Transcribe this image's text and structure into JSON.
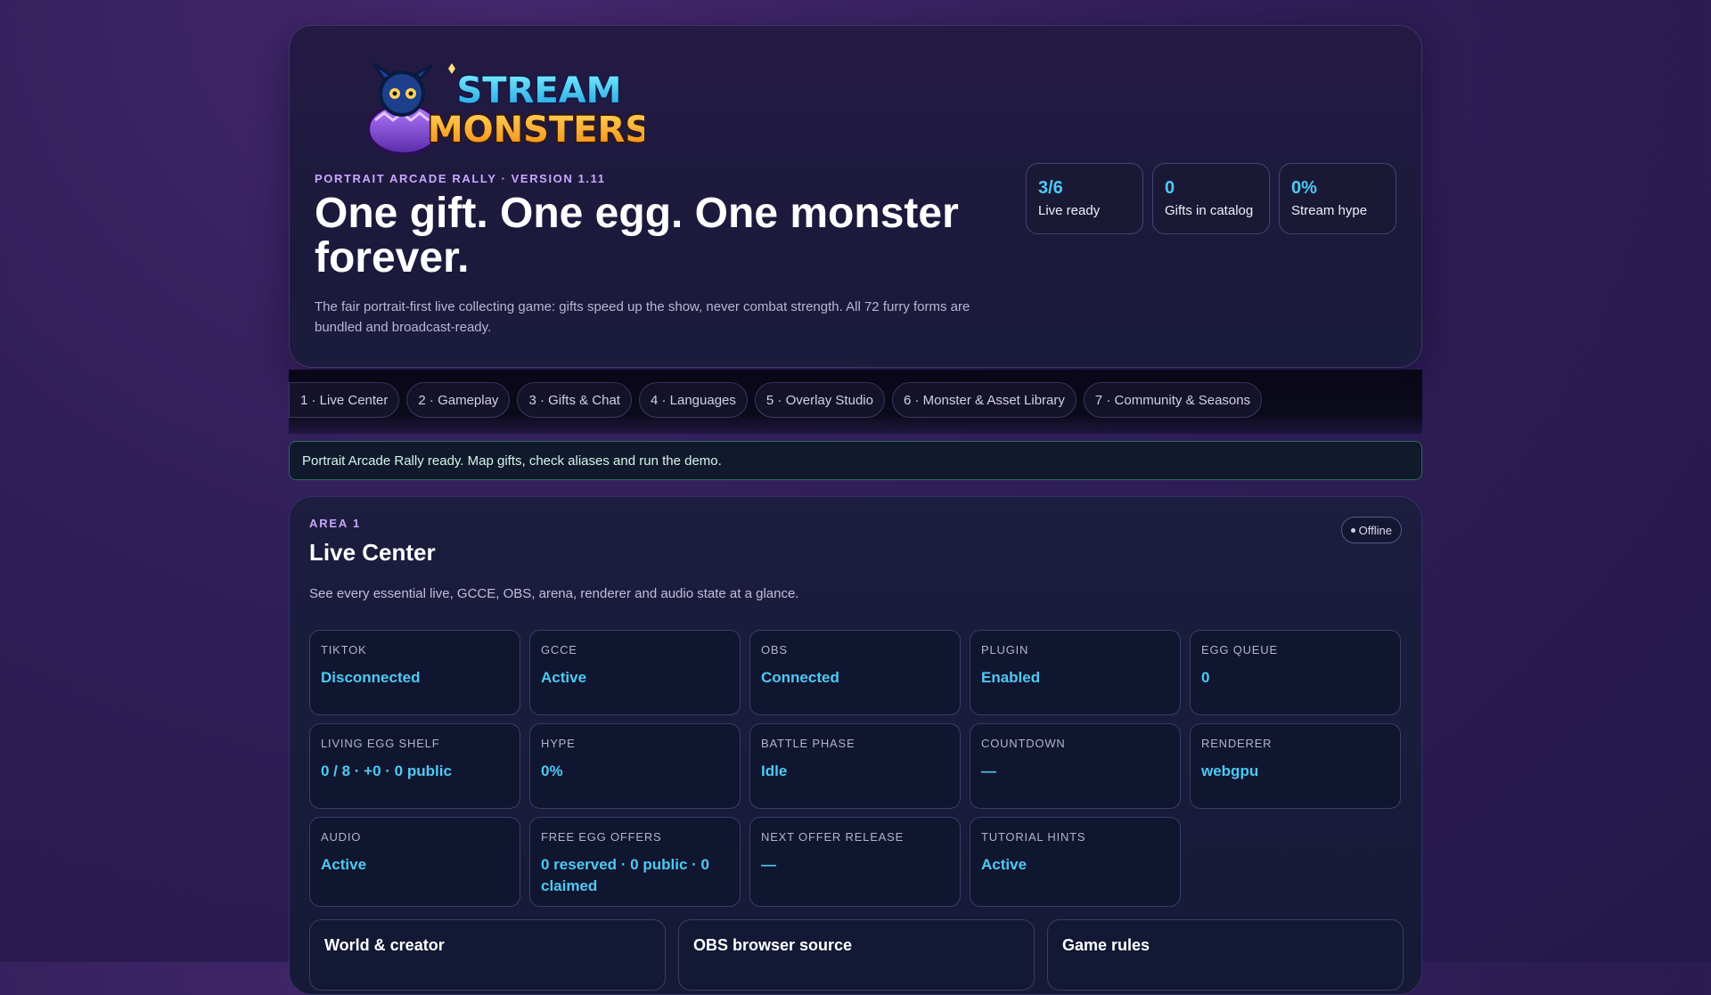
{
  "hero": {
    "logo_text": "STREAM MONSTERS",
    "eyebrow": "PORTRAIT ARCADE RALLY · VERSION 1.11",
    "title": "One gift. One egg. One monster forever.",
    "subtitle": "The fair portrait-first live collecting game: gifts speed up the show, never combat strength. All 72 furry forms are bundled and broadcast-ready.",
    "stats": [
      {
        "value": "3/6",
        "label": "Live ready"
      },
      {
        "value": "0",
        "label": "Gifts in catalog"
      },
      {
        "value": "0%",
        "label": "Stream hype"
      }
    ]
  },
  "tabs": [
    {
      "label": "1 · Live Center"
    },
    {
      "label": "2 · Gameplay"
    },
    {
      "label": "3 · Gifts & Chat"
    },
    {
      "label": "4 · Languages"
    },
    {
      "label": "5 · Overlay Studio"
    },
    {
      "label": "6 · Monster & Asset Library"
    },
    {
      "label": "7 · Community & Seasons"
    }
  ],
  "notice": "Portrait Arcade Rally ready. Map gifts, check aliases and run the demo.",
  "area": {
    "tag": "AREA 1",
    "title": "Live Center",
    "description": "See every essential live, GCCE, OBS, arena, renderer and audio state at a glance.",
    "status": "Offline",
    "cells": [
      {
        "key": "TIKTOK",
        "value": "Disconnected"
      },
      {
        "key": "GCCE",
        "value": "Active"
      },
      {
        "key": "OBS",
        "value": "Connected"
      },
      {
        "key": "PLUGIN",
        "value": "Enabled"
      },
      {
        "key": "EGG QUEUE",
        "value": "0"
      },
      {
        "key": "LIVING EGG SHELF",
        "value": "0 / 8 · +0 · 0 public"
      },
      {
        "key": "HYPE",
        "value": "0%"
      },
      {
        "key": "BATTLE PHASE",
        "value": "Idle"
      },
      {
        "key": "COUNTDOWN",
        "value": "—"
      },
      {
        "key": "RENDERER",
        "value": "webgpu"
      },
      {
        "key": "AUDIO",
        "value": "Active"
      },
      {
        "key": "FREE EGG OFFERS",
        "value": "0 reserved · 0 public · 0 claimed"
      },
      {
        "key": "NEXT OFFER RELEASE",
        "value": "—"
      },
      {
        "key": "TUTORIAL HINTS",
        "value": "Active"
      }
    ],
    "panels": [
      {
        "title": "World & creator"
      },
      {
        "title": "OBS browser source"
      },
      {
        "title": "Game rules"
      }
    ]
  },
  "colors": {
    "accent": "#4fc9f2",
    "eyebrow": "#c9a7ff",
    "background": "#2f1e58"
  }
}
